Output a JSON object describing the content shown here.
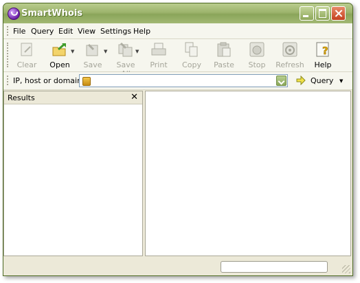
{
  "window": {
    "title": "SmartWhois",
    "icon": "smartwhois-app-icon"
  },
  "menu": [
    "File",
    "Query",
    "Edit",
    "View",
    "Settings",
    "Help"
  ],
  "toolbar": {
    "clear": "Clear",
    "open": "Open",
    "save": "Save",
    "save_all": "Save All",
    "print": "Print",
    "copy": "Copy",
    "paste": "Paste",
    "stop": "Stop",
    "refresh": "Refresh",
    "help": "Help"
  },
  "address": {
    "label": "IP, host or domain:",
    "value": "",
    "query_label": "Query"
  },
  "results_pane": {
    "title": "Results",
    "close_glyph": "✕"
  },
  "colors": {
    "title_bar": "#9db46c",
    "close_button": "#c3401e",
    "frame": "#ece9d8"
  }
}
